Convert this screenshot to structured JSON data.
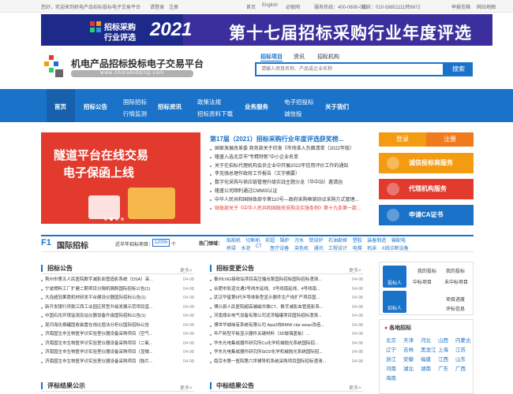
{
  "topbar": {
    "welcome": "您好，欢迎来到机电产品招标投标电子交易平台",
    "login": "请登录",
    "register": "注册",
    "home": "首页",
    "english": "English",
    "sitemap": "必联网",
    "hotline": "服务热线：400-0606-000",
    "complaint": "投诉：010-58851111转8672",
    "report": "举报信箱",
    "map": "网站地图"
  },
  "banner": {
    "logo_line1": "招标采购",
    "logo_line2": "行业评选",
    "year": "2021",
    "title": "第十七届招标采购行业年度评选"
  },
  "header": {
    "title": "机电产品招标投标电子交易平台",
    "subtitle": "www.chinabidding.com",
    "tabs": [
      "招标项目",
      "资讯",
      "招标机构"
    ],
    "search_placeholder": "请输入项目名称、产品或企业名称",
    "search_button": "搜索"
  },
  "nav": {
    "home": "首页",
    "bid_notice": "招标公告",
    "intl_bid": "国际招标",
    "industry_monitor": "行情监测",
    "bid_news": "招标资讯",
    "policy": "政策法规",
    "bid_download": "招标资料下载",
    "business": "业务服务",
    "e_bid": "电子招投标",
    "credit": "诚信投",
    "about": "关于我们"
  },
  "slide": {
    "line1": "隧道平台在线交易",
    "line2": "电子保函上线"
  },
  "news": {
    "headline": "第17届（2021）招标采购行业年度评选获奖榜...",
    "items": [
      "国家发展改革委 商务部关于印发《市场准入负面清单（2022年版）",
      "隆盛入选北京市“专精特新”中小企业名单",
      "关于在招标代理机构会员企业中开展2022年信用评价工作的通知",
      "李克强总理作政府工作报告（文字摘要）",
      "数字化采购与供应链管理升级实战主题沙龙（华中站）邀请函",
      "隆盛公司顺利通过CMMI3认证",
      "中华人民共和国财政部令第110号—政府采购框架协议采购方式管理...",
      "财政部关于《中华人民共和国政府采购法实施条例》第十九条第一款..."
    ]
  },
  "side": {
    "login": "登录",
    "register": "注册",
    "btn1": "诚信投标商服务",
    "btn2": "代理机构服务",
    "btn3": "申请CA证书"
  },
  "f1": {
    "label": "F1",
    "title": "国际招标",
    "count_label": "近半年招标项目：",
    "count": "12005",
    "unit": "个",
    "hot_label": "热门领域：",
    "hot_row1": [
      "船舶机",
      "切割机",
      "彩超",
      "锅炉",
      "污水",
      "焚烧炉",
      "石油勘探",
      "塑胶",
      "装备制造",
      "输配电"
    ],
    "hot_row2": [
      "桥梁",
      "水泥",
      "CT",
      "医疗设备",
      "染色机",
      "通讯",
      "工程设计",
      "电梯",
      "机床",
      "X线诊断设备"
    ]
  },
  "bid_notice": {
    "title": "招标公告",
    "more": "更多>",
    "items": [
      {
        "t": "荆州市第五人民医院数字减影血管造影系统（DSA）采...",
        "d": "04-08"
      },
      {
        "t": "宁波燃料工厂扩建二期项目分隔机隔断国际招标公告(1)",
        "d": "04-08"
      },
      {
        "t": "大连超冠果蔬机材研发平台建设仪器国际招标公告(1)",
        "d": "04-08"
      },
      {
        "t": "新开发银行贷款江西工业园区转型升级发展示范项目直...",
        "d": "04-08"
      },
      {
        "t": "中国石化环境监测及站仪器设备升级国际招标公告(1)",
        "d": "04-08"
      },
      {
        "t": "现河海化祸罐固收装置在线比值法分析仪国际招标公告",
        "d": "04-08"
      },
      {
        "t": "济南国生市生物医学诊实验室仪器设备采购项目（空气...",
        "d": "04-08"
      },
      {
        "t": "济南国生市生物医学诊实验室仪器设备采购项目（二氧...",
        "d": "04-08"
      },
      {
        "t": "济南国生市生物医学诊实验室仪器设备采购项目（显微...",
        "d": "04-08"
      },
      {
        "t": "济南国生市生物医学诊实验室仪器设备采购项目（肢片...",
        "d": "04-08"
      }
    ]
  },
  "bid_change": {
    "title": "招标变更公告",
    "more": "更多>",
    "items": [
      {
        "t": "泰州LNG接收站项目高压输出泵国际招标国际招标澄清...",
        "d": "04-08"
      },
      {
        "t": "合肥市轨道交通2号线东延线、3号线南延线、4号线南...",
        "d": "04-08"
      },
      {
        "t": "武汉华星第6代半导体新型显示器件生产线扩产项目国...",
        "d": "04-08"
      },
      {
        "t": "博兴县人民医院超高端磁共振CT、数字减影血管造影系...",
        "d": "04-08"
      },
      {
        "t": "河南煤业电气设备有限公司泥浮箱罐项目国际招标澄清...",
        "d": "04-08"
      },
      {
        "t": "博世华城纳有系统有限公司 Apa2线BMW clar weac改造...",
        "d": "04-08"
      },
      {
        "t": "年产新型平板显示器件关键材料（3D玻璃盖板）...",
        "d": "04-08"
      },
      {
        "t": "华东光电集成器件研究所Cu化学机械抛光系统国际招...",
        "d": "04-08"
      },
      {
        "t": "华东光电集成器件研究所SiO2化学机械抛光系统国际招...",
        "d": "04-08"
      },
      {
        "t": "南京市第一医院第六世辅导机系统采购项目国际招标澄清...",
        "d": "04-08"
      }
    ]
  },
  "svc": {
    "bidder": "投标人",
    "my_bid": "我的投标",
    "my_project": "中标项目",
    "unbid": "未中标项目",
    "tenderer": "招标人",
    "project_progress": "项目进度",
    "review_info": "评标信息"
  },
  "regions": {
    "title": "各地招标",
    "items": [
      "北京",
      "天津",
      "河北",
      "山西",
      "内蒙古",
      "辽宁",
      "吉林",
      "黑龙江",
      "上海",
      "江苏",
      "浙江",
      "安徽",
      "福建",
      "江西",
      "山东",
      "河南",
      "湖北",
      "湖南",
      "广东",
      "广西",
      "海南"
    ]
  },
  "bottom": {
    "review_title": "评标结果公示",
    "win_title": "中标结果公告",
    "more": "更多>"
  }
}
